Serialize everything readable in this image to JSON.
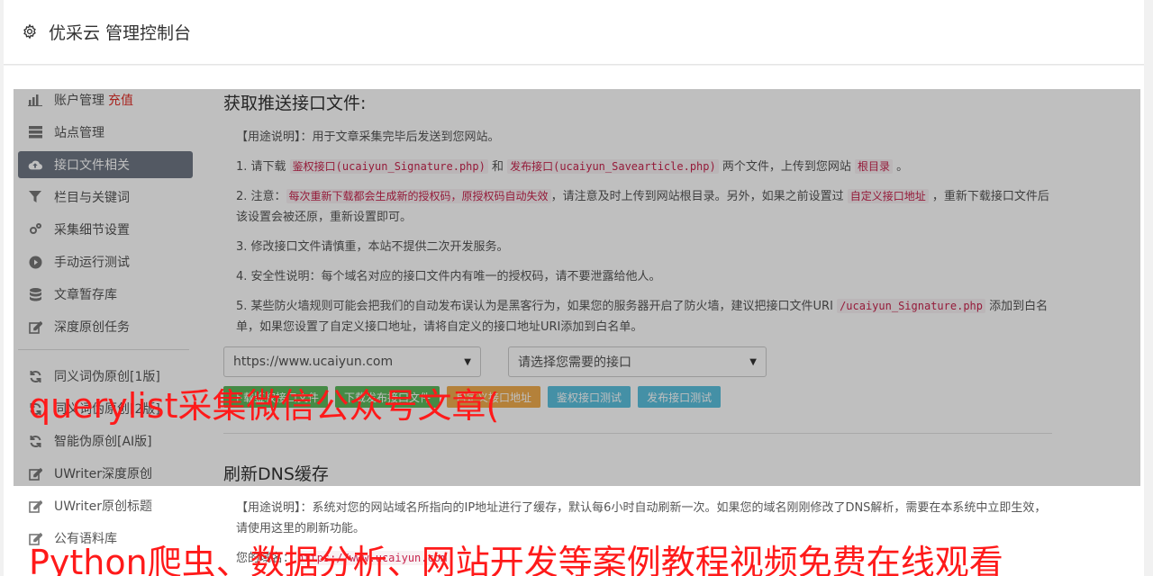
{
  "header": {
    "title": "优采云 管理控制台"
  },
  "sidebar": {
    "items": [
      {
        "label": "账户管理",
        "extra": "充值",
        "icon": "bar-chart-icon"
      },
      {
        "label": "站点管理",
        "icon": "server-icon"
      },
      {
        "label": "接口文件相关",
        "icon": "cloud-upload-icon"
      },
      {
        "label": "栏目与关键词",
        "icon": "filter-icon"
      },
      {
        "label": "采集细节设置",
        "icon": "cogs-icon"
      },
      {
        "label": "手动运行测试",
        "icon": "play-circle-icon"
      },
      {
        "label": "文章暂存库",
        "icon": "database-icon"
      },
      {
        "label": "深度原创任务",
        "icon": "edit-icon"
      }
    ],
    "items2": [
      {
        "label": "同义词伪原创[1版]",
        "icon": "refresh-icon"
      },
      {
        "label": "同义词伪原创[2版]",
        "icon": "refresh-icon"
      },
      {
        "label": "智能伪原创[AI版]",
        "icon": "refresh-icon"
      },
      {
        "label": "UWriter深度原创",
        "icon": "edit-icon"
      },
      {
        "label": "UWriter原创标题",
        "icon": "edit-icon"
      },
      {
        "label": "公有语料库",
        "icon": "edit-icon"
      }
    ]
  },
  "main": {
    "section1": {
      "title": "获取推送接口文件:",
      "usage": "【用途说明】：用于文章采集完毕后发送到您网站。",
      "p1_a": "1. 请下载 ",
      "p1_code1": "鉴权接口(ucaiyun_Signature.php)",
      "p1_b": " 和 ",
      "p1_code2": "发布接口(ucaiyun_Savearticle.php)",
      "p1_c": " 两个文件，上传到您网站 ",
      "p1_code3": "根目录",
      "p1_d": " 。",
      "p2_a": "2. 注意：",
      "p2_code1": "每次重新下载都会生成新的授权码，原授权码自动失效",
      "p2_b": "，请注意及时上传到网站根目录。另外，如果之前设置过 ",
      "p2_code2": "自定义接口地址",
      "p2_c": " ，重新下载接口文件后该设置会被还原，重新设置即可。",
      "p3": "3. 修改接口文件请慎重，本站不提供二次开发服务。",
      "p4": "4. 安全性说明：每个域名对应的接口文件内有唯一的授权码，请不要泄露给他人。",
      "p5_a": "5. 某些防火墙规则可能会把我们的自动发布误认为是黑客行为，如果您的服务器开启了防火墙，建议把接口文件URI ",
      "p5_code": "/ucaiyun_Signature.php",
      "p5_b": " 添加到白名单，如果您设置了自定义接口地址，请将自定义的接口地址URI添加到白名单。",
      "select_site": "https://www.ucaiyun.com",
      "select_iface": "请选择您需要的接口",
      "btn1": "下载鉴权接口文件",
      "btn2": "下载发布接口文件",
      "btn3": "自定义接口地址",
      "btn4": "鉴权接口测试",
      "btn5": "发布接口测试"
    },
    "section2": {
      "title": "刷新DNS缓存",
      "usage": "【用途说明】：系统对您的网站域名所指向的IP地址进行了缓存，默认每6小时自动刷新一次。如果您的域名刚刚修改了DNS解析，需要在本系统中立即生效，请使用这里的刷新功能。",
      "domain_label": "您的域名：",
      "domain_value": "https://www.ucaiyun.com"
    }
  },
  "watermark": {
    "line1": "querylist采集微信公众号文章(",
    "line2": "Python爬虫、数据分析、网站开发等案例教程视频免费在线观看"
  }
}
